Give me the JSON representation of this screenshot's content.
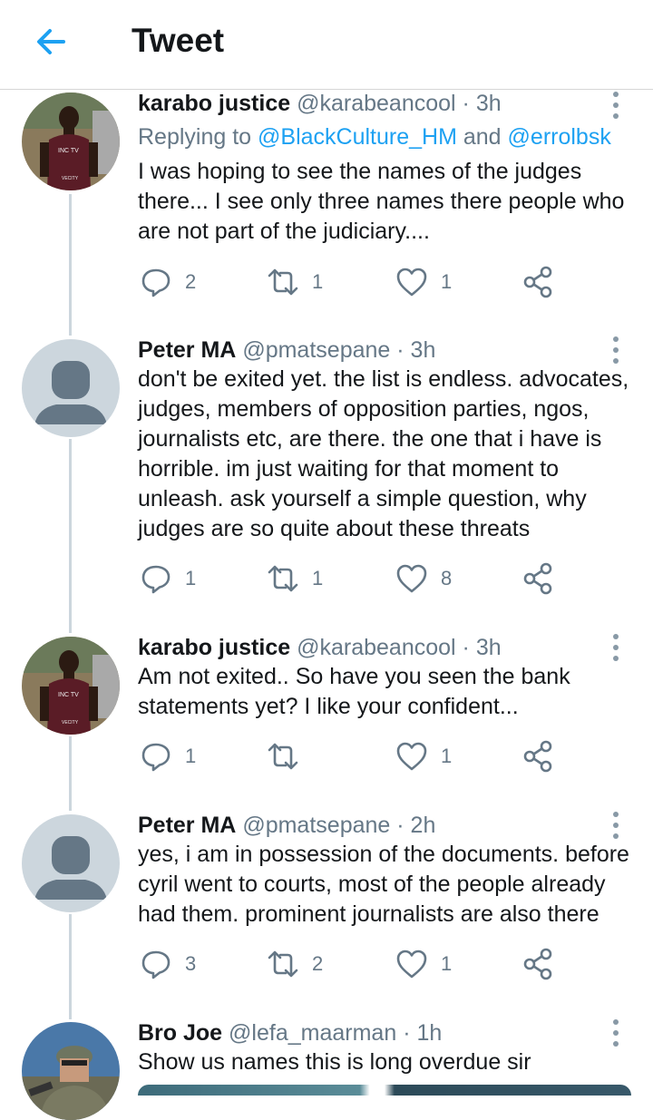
{
  "header": {
    "title": "Tweet",
    "back_icon": "arrow-left-icon"
  },
  "colors": {
    "accent": "#1da1f2",
    "secondary_text": "#657786",
    "thread_line": "#ccd6dd"
  },
  "tweets": [
    {
      "name": "karabo justice",
      "handle": "@karabeancool",
      "time": "· 3h",
      "replying": {
        "prefix": "Replying to ",
        "mention1": "@BlackCulture_HM",
        "joiner": " and ",
        "mention2": "@errolbsk"
      },
      "text": "I was hoping to see the names of the judges there... I see only three names there people who are not part of the judiciary....",
      "replies": "2",
      "retweets": "1",
      "likes": "1"
    },
    {
      "name": "Peter MA",
      "handle": "@pmatsepane",
      "time": "· 3h",
      "text": "don't be exited yet. the list is endless. advocates, judges, members of opposition parties, ngos, journalists etc, are there. the one that i have is horrible. im just waiting for that moment to unleash. ask yourself a simple question, why judges are so quite about these threats",
      "replies": "1",
      "retweets": "1",
      "likes": "8"
    },
    {
      "name": "karabo justice",
      "handle": "@karabeancool",
      "time": "· 3h",
      "text": "Am not exited.. So have you seen the bank statements yet? I like your confident...",
      "replies": "1",
      "retweets": "",
      "likes": "1"
    },
    {
      "name": "Peter MA",
      "handle": "@pmatsepane",
      "time": "· 2h",
      "text": "yes, i am in possession of the documents. before cyril went to courts, most of the people already had them. prominent journalists are also there",
      "replies": "3",
      "retweets": "2",
      "likes": "1"
    },
    {
      "name": "Bro Joe",
      "handle": "@lefa_maarman",
      "time": "· 1h",
      "text": "Show us names this is long overdue sir"
    }
  ]
}
